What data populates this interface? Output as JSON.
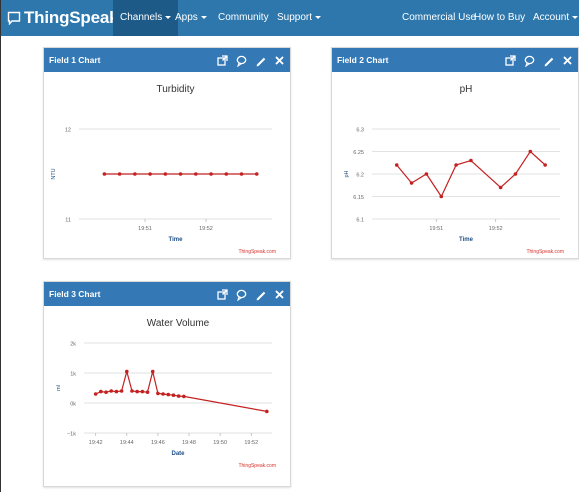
{
  "nav": {
    "logo": "ThingSpeak™",
    "channels": "Channels",
    "apps": "Apps",
    "community": "Community",
    "support": "Support",
    "commercial": "Commercial Use",
    "how_to_buy": "How to Buy",
    "account": "Account"
  },
  "colors": {
    "navbar": "#2d77ad",
    "panel_header": "#3479b5",
    "series": "#c42121",
    "credit": "#d9302a",
    "axis_title": "#1f4e86"
  },
  "panels": [
    {
      "title": "Field 1 Chart",
      "credit": "ThingSpeak.com"
    },
    {
      "title": "Field 2 Chart",
      "credit": "ThingSpeak.com"
    },
    {
      "title": "Field 3 Chart",
      "credit": "ThingSpeak.com"
    }
  ],
  "icons": [
    "external-link-icon",
    "comment-icon",
    "pencil-icon",
    "close-icon"
  ],
  "chart_data": [
    {
      "type": "line",
      "title": "Turbidity",
      "xlabel": "Time",
      "ylabel": "NTU",
      "ylim": [
        11,
        12
      ],
      "yticks": [
        "11",
        "12"
      ],
      "xticks": [
        "19:51",
        "19:52"
      ],
      "x": [
        "19:50:20",
        "19:50:35",
        "19:50:50",
        "19:51:05",
        "19:51:20",
        "19:51:35",
        "19:51:50",
        "19:52:05",
        "19:52:20",
        "19:52:35",
        "19:52:50"
      ],
      "values": [
        11.5,
        11.5,
        11.5,
        11.5,
        11.5,
        11.5,
        11.5,
        11.5,
        11.5,
        11.5,
        11.5
      ],
      "grid": true
    },
    {
      "type": "line",
      "title": "pH",
      "xlabel": "Time",
      "ylabel": "pH",
      "ylim": [
        6.1,
        6.3
      ],
      "yticks": [
        "6.1",
        "6.15",
        "6.2",
        "6.25",
        "6.3"
      ],
      "xticks": [
        "19:51",
        "19:52"
      ],
      "x": [
        "19:50:20",
        "19:50:35",
        "19:50:50",
        "19:51:05",
        "19:51:20",
        "19:51:35",
        "19:52:05",
        "19:52:20",
        "19:52:35",
        "19:52:50"
      ],
      "values": [
        6.22,
        6.18,
        6.2,
        6.15,
        6.22,
        6.23,
        6.17,
        6.2,
        6.25,
        6.22
      ],
      "grid": true
    },
    {
      "type": "line",
      "title": "Water Volume",
      "xlabel": "Date",
      "ylabel": "ml",
      "ylim": [
        -1000,
        2000
      ],
      "yticks": [
        "−1k",
        "0k",
        "1k",
        "2k"
      ],
      "xticks": [
        "19:42",
        "19:44",
        "19:46",
        "19:48",
        "19:50",
        "19:52"
      ],
      "x": [
        "19:42:00",
        "19:42:20",
        "19:42:40",
        "19:43:00",
        "19:43:20",
        "19:43:40",
        "19:44:00",
        "19:44:20",
        "19:44:40",
        "19:45:00",
        "19:45:20",
        "19:45:40",
        "19:46:00",
        "19:46:20",
        "19:46:40",
        "19:47:00",
        "19:47:20",
        "19:47:40",
        "19:53:00"
      ],
      "values": [
        300,
        380,
        360,
        400,
        380,
        400,
        1050,
        400,
        380,
        380,
        360,
        1050,
        320,
        300,
        280,
        260,
        230,
        220,
        -280
      ],
      "grid": true
    }
  ]
}
